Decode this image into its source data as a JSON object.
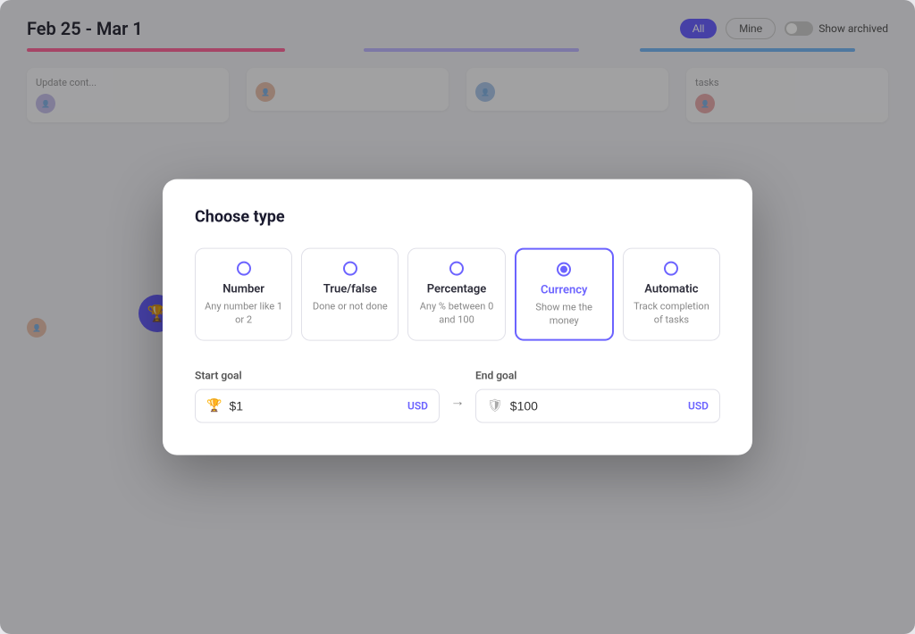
{
  "dashboard": {
    "date_range": "Feb 25 - Mar 1",
    "tab_all": "All",
    "tab_mine": "Mine",
    "toggle_label": "Show archived",
    "cards": [
      {
        "text": "Update cont...",
        "id": "c1"
      },
      {
        "text": "tasks",
        "id": "c2"
      }
    ]
  },
  "modal": {
    "title": "Choose type",
    "options": [
      {
        "id": "number",
        "name": "Number",
        "desc": "Any number like 1 or 2",
        "selected": false
      },
      {
        "id": "true_false",
        "name": "True/false",
        "desc": "Done or not done",
        "selected": false
      },
      {
        "id": "percentage",
        "name": "Percentage",
        "desc": "Any % between 0 and 100",
        "selected": false
      },
      {
        "id": "currency",
        "name": "Currency",
        "desc": "Show me the money",
        "selected": true
      },
      {
        "id": "automatic",
        "name": "Automatic",
        "desc": "Track completion of tasks",
        "selected": false
      }
    ],
    "start_goal": {
      "label": "Start goal",
      "value": "$1",
      "currency": "USD"
    },
    "end_goal": {
      "label": "End goal",
      "value": "$100",
      "currency": "USD"
    }
  },
  "icons": {
    "trophy": "🏆",
    "shield": "🛡",
    "arrow_right": "→"
  }
}
